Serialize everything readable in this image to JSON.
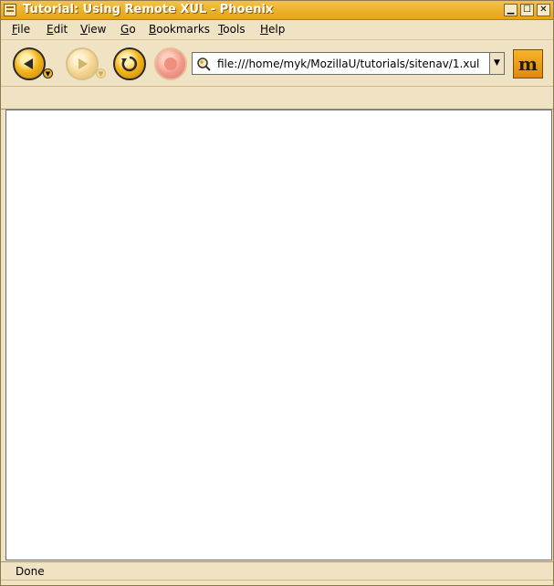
{
  "window": {
    "title": "Tutorial: Using Remote XUL - Phoenix"
  },
  "menu": {
    "items": [
      {
        "accel": "F",
        "rest": "ile"
      },
      {
        "accel": "E",
        "rest": "dit"
      },
      {
        "accel": "V",
        "rest": "iew"
      },
      {
        "accel": "G",
        "rest": "o"
      },
      {
        "accel": "B",
        "rest": "ookmarks"
      },
      {
        "accel": "T",
        "rest": "ools"
      },
      {
        "accel": "H",
        "rest": "elp"
      }
    ]
  },
  "navigation": {
    "url": "file:///home/myk/MozillaU/tutorials/sitenav/1.xul",
    "back_icon": "back-arrow-icon",
    "forward_icon": "forward-arrow-icon",
    "reload_icon": "reload-icon",
    "stop_icon": "stop-icon",
    "accent": "#f5b71d"
  },
  "status": {
    "text": "Done"
  }
}
